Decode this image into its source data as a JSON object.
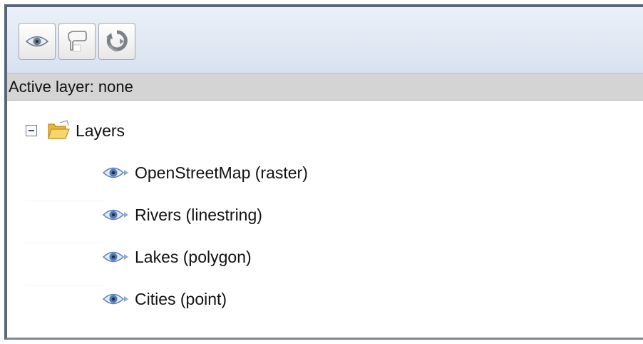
{
  "toolbar": {
    "buttons": [
      {
        "icon": "eye-icon",
        "name": "visibility-button"
      },
      {
        "icon": "select-icon",
        "name": "select-button"
      },
      {
        "icon": "refresh-icon",
        "name": "refresh-button"
      }
    ]
  },
  "status": {
    "active_layer": "Active layer: none"
  },
  "tree": {
    "root_label": "Layers",
    "root_icon": "folder-open-icon",
    "layers": [
      {
        "label": "OpenStreetMap (raster)",
        "icon": "eye-icon"
      },
      {
        "label": "Rivers (linestring)",
        "icon": "eye-icon"
      },
      {
        "label": "Lakes (polygon)",
        "icon": "eye-icon"
      },
      {
        "label": "Cities (point)",
        "icon": "eye-icon"
      }
    ]
  },
  "colors": {
    "frame": "#596679",
    "toolbar": "#d8e2ef",
    "statusbar": "#d4d4d4",
    "eye": "#3a73c4",
    "folder": "#f2c94c"
  }
}
